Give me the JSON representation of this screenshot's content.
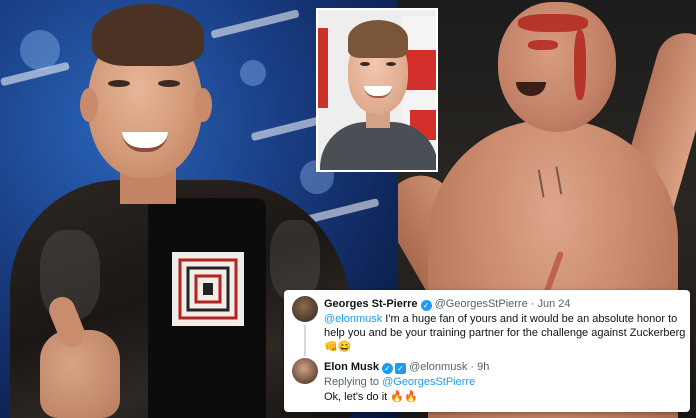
{
  "photos": {
    "left": {
      "subject": "musk-photo"
    },
    "inset": {
      "subject": "zuckerberg-photo"
    },
    "right": {
      "subject": "st-pierre-photo"
    }
  },
  "tweet_card": {
    "first_tweet": {
      "name": "Georges St-Pierre",
      "handle": "@GeorgesStPierre",
      "separator": "·",
      "date": "Jun 24",
      "mention": "@elonmusk",
      "text_line1": " I'm a huge fan of yours and it would be an absolute honor to",
      "text_line2": "help you and be your training partner for the challenge against Zuckerberg",
      "emojis": "👊😄"
    },
    "reply": {
      "name": "Elon Musk",
      "handle": "@elonmusk",
      "separator": "·",
      "time": "9h",
      "replying_prefix": "Replying to ",
      "replying_handle": "@GeorgesStPierre",
      "text": "Ok, let's do it",
      "emojis": "🔥🔥"
    }
  },
  "icons": {
    "verified": "verified-check-icon",
    "twitter_badge": "twitter-blue-badge-icon"
  },
  "colors": {
    "accent": "#1d9bf0",
    "text": "#0f1419",
    "muted": "#536471"
  }
}
